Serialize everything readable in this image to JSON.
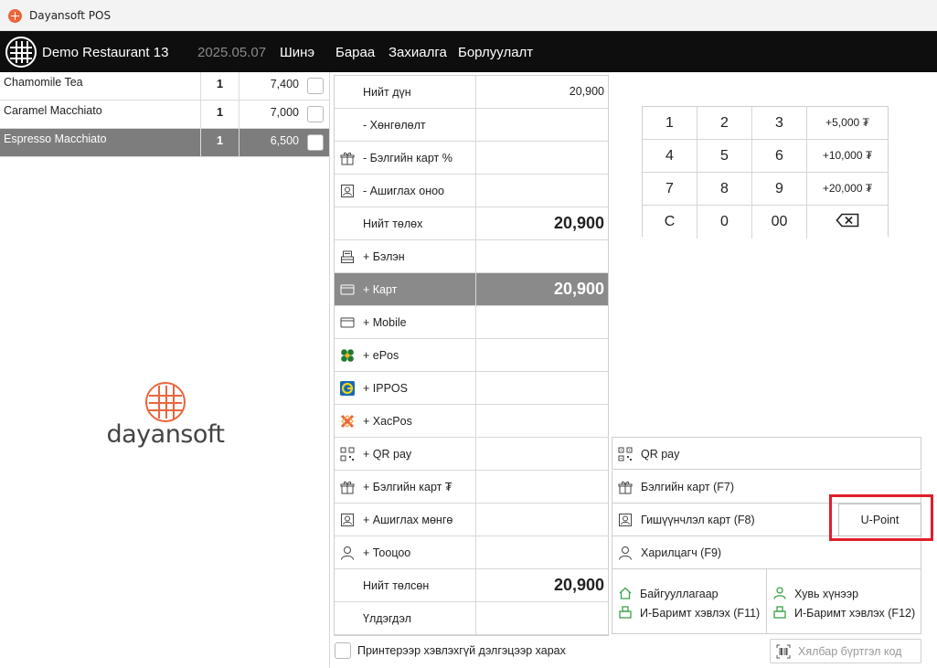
{
  "window": {
    "title": "Dayansoft POS"
  },
  "nav": {
    "store": "Demo Restaurant 13",
    "date": "2025.05.07",
    "menu": [
      "Шинэ",
      "Бараа",
      "Захиалга",
      "Борлуулалт"
    ]
  },
  "orders": [
    {
      "name": "Chamomile Tea",
      "qty": "1",
      "price": "7,400",
      "selected": false
    },
    {
      "name": "Caramel Macchiato",
      "qty": "1",
      "price": "7,000",
      "selected": false
    },
    {
      "name": "Espresso Macchiato",
      "qty": "1",
      "price": "6,500",
      "selected": true
    }
  ],
  "brand": {
    "wordmark": "dayansoft",
    "accent": "#e9663d"
  },
  "payments": [
    {
      "label": "Нийт дүн",
      "value": "20,900",
      "icon": "",
      "big": false
    },
    {
      "label": "- Хөнгөлөлт",
      "value": "",
      "icon": "",
      "big": false
    },
    {
      "label": "- Бэлгийн карт %",
      "value": "",
      "icon": "gift-icon",
      "big": false
    },
    {
      "label": "- Ашиглах оноо",
      "value": "",
      "icon": "member-card-icon",
      "big": false
    },
    {
      "label": "Нийт төлөх",
      "value": "20,900",
      "icon": "",
      "big": true
    },
    {
      "label": "+ Бэлэн",
      "value": "",
      "icon": "cash-register-icon",
      "big": false
    },
    {
      "label": "+ Карт",
      "value": "20,900",
      "icon": "card-icon",
      "big": true,
      "selected": true
    },
    {
      "label": "+ Mobile",
      "value": "",
      "icon": "card-icon",
      "big": false
    },
    {
      "label": "+ ePos",
      "value": "",
      "icon": "epos-icon",
      "big": false
    },
    {
      "label": "+ IPPOS",
      "value": "",
      "icon": "ippos-icon",
      "big": false
    },
    {
      "label": "+ XacPos",
      "value": "",
      "icon": "xacpos-icon",
      "big": false
    },
    {
      "label": "+ QR pay",
      "value": "",
      "icon": "qr-icon",
      "big": false
    },
    {
      "label": "+ Бэлгийн карт ₮",
      "value": "",
      "icon": "gift-icon",
      "big": false
    },
    {
      "label": "+ Ашиглах мөнгө",
      "value": "",
      "icon": "member-card-icon",
      "big": false
    },
    {
      "label": "+ Тооцоо",
      "value": "",
      "icon": "person-icon",
      "big": false
    },
    {
      "label": "Нийт төлсөн",
      "value": "20,900",
      "icon": "",
      "big": true
    },
    {
      "label": "Үлдэгдэл",
      "value": "",
      "icon": "",
      "big": false
    }
  ],
  "keypad": [
    [
      "1",
      "2",
      "3",
      "+5,000 ₮"
    ],
    [
      "4",
      "5",
      "6",
      "+10,000 ₮"
    ],
    [
      "7",
      "8",
      "9",
      "+20,000 ₮"
    ],
    [
      "C",
      "0",
      "00",
      "backspace-icon"
    ]
  ],
  "options": [
    {
      "label": "QR pay",
      "icon": "qr-icon"
    },
    {
      "label": "Бэлгийн карт (F7)",
      "icon": "gift-icon"
    },
    {
      "label": "Гишүүнчлэл карт (F8)",
      "icon": "member-card-icon"
    },
    {
      "label": "Харилцагч (F9)",
      "icon": "person-icon"
    }
  ],
  "upoint": {
    "label": "U-Point",
    "highlight_color": "#e01e2b"
  },
  "receipt": {
    "org": {
      "title": "Байгууллагаар",
      "print": "И-Баримт хэвлэх (F11)"
    },
    "person": {
      "title": "Хувь хүнээр",
      "print": "И-Баримт хэвлэх (F12)"
    }
  },
  "footer": {
    "print_label": "Принтерээр хэвлэхгүй дэлгэцээр харах",
    "easy_code_placeholder": "Хялбар бүртгэл код"
  }
}
